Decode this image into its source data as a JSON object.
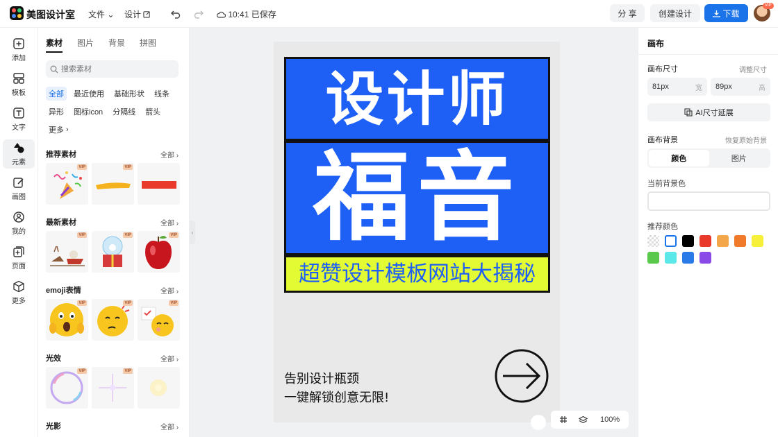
{
  "app": {
    "name": "美图设计室"
  },
  "topbar": {
    "file_menu": "文件",
    "design_menu": "设计",
    "save_status": "10:41 已保存",
    "share": "分 享",
    "create": "创建设计",
    "download": "下载",
    "avatar_badge": "VIP"
  },
  "rail": [
    {
      "label": "添加",
      "icon": "plus-square-icon"
    },
    {
      "label": "模板",
      "icon": "template-icon"
    },
    {
      "label": "文字",
      "icon": "text-icon"
    },
    {
      "label": "元素",
      "icon": "shapes-icon",
      "active": true
    },
    {
      "label": "画图",
      "icon": "pencil-icon"
    },
    {
      "label": "我的",
      "icon": "user-icon"
    },
    {
      "label": "页面",
      "icon": "add-page-icon"
    },
    {
      "label": "更多",
      "icon": "cube-icon"
    }
  ],
  "panel": {
    "tabs": [
      "素材",
      "图片",
      "背景",
      "拼图"
    ],
    "search_placeholder": "搜索素材",
    "filters": [
      "全部",
      "最近使用",
      "基础形状",
      "线条",
      "异形",
      "图标icon",
      "分隔线",
      "箭头",
      "更多"
    ],
    "all_label": "全部",
    "vip_label": "VIP",
    "sections": [
      {
        "title": "推荐素材"
      },
      {
        "title": "最新素材"
      },
      {
        "title": "emoji表情"
      },
      {
        "title": "光效"
      },
      {
        "title": "光影"
      }
    ]
  },
  "canvas": {
    "line1": "设计师",
    "line2": "福音",
    "line3": "超赞设计模板网站大揭秘",
    "tagline1": "告别设计瓶颈",
    "tagline2": "一键解锁创意无限!",
    "blue": "#1e5ff5",
    "yellow": "#e2fb32"
  },
  "zoom": {
    "level": "100%"
  },
  "rpanel": {
    "title": "画布",
    "size_label": "画布尺寸",
    "adjust_size": "调整尺寸",
    "width_value": "81px",
    "width_unit": "宽",
    "height_value": "89px",
    "height_unit": "高",
    "ai_extend": "AI尺寸延展",
    "bg_label": "画布背景",
    "restore_bg": "恢复原始背景",
    "seg_color": "颜色",
    "seg_image": "图片",
    "current_bg": "当前背景色",
    "recommended": "推荐颜色",
    "swatches": [
      "transparent",
      "#ffffff",
      "#000000",
      "#e8392b",
      "#f4a64a",
      "#f07a2a",
      "#f6f03a",
      "#5ac84a",
      "#5ae8e8",
      "#2a7ae8",
      "#8a4ae8"
    ]
  }
}
